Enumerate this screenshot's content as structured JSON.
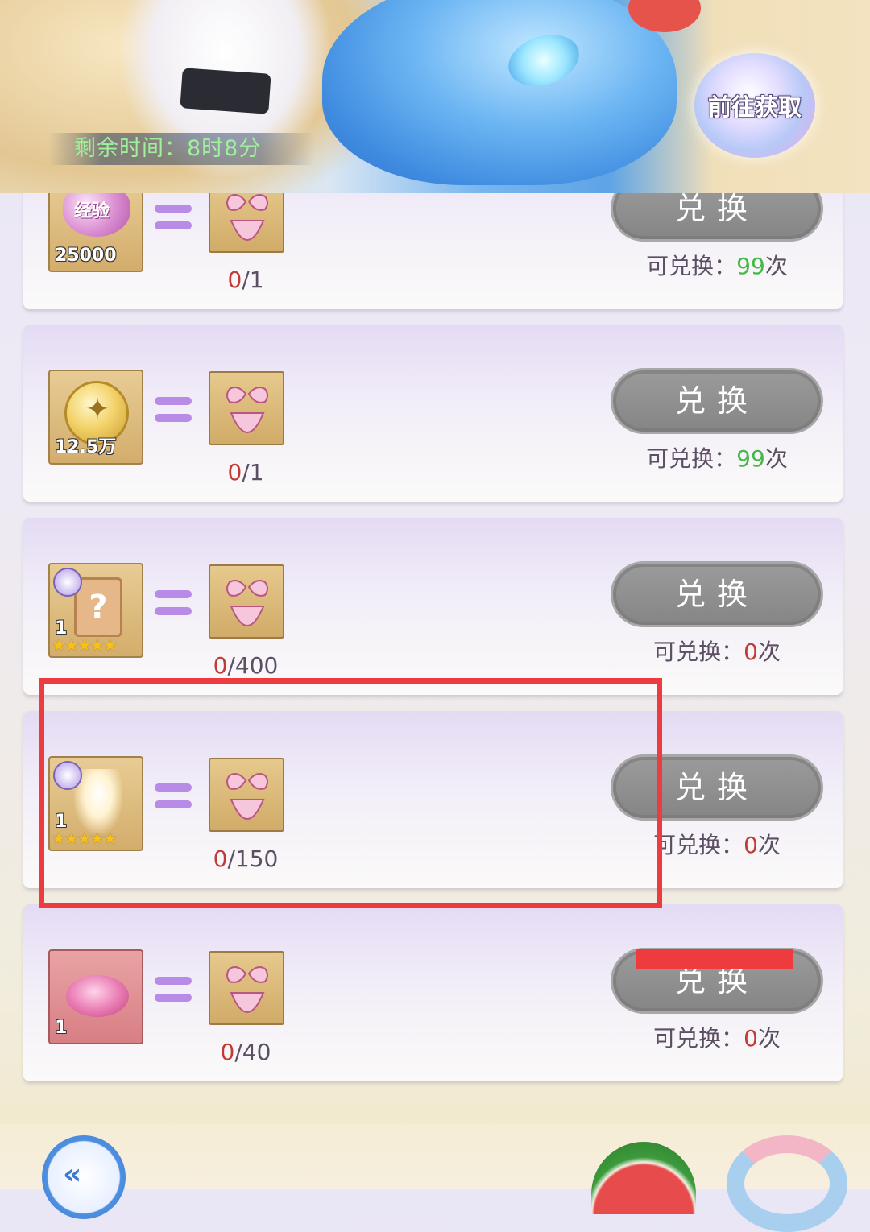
{
  "banner": {
    "timer_text": "剩余时间：8时8分",
    "goto_button_label": "前往获取"
  },
  "rows": [
    {
      "item_icon": "experience-heart-icon",
      "item_label": "经验",
      "item_qty": "25000",
      "reward_icon": "bikini-icon",
      "progress_have": "0",
      "progress_need": "/1",
      "button_label": "兑换",
      "limit_prefix": "可兑换：",
      "limit_count": "99",
      "limit_suffix": "次"
    },
    {
      "item_icon": "gold-coin-icon",
      "item_qty": "12.5万",
      "reward_icon": "bikini-icon",
      "progress_have": "0",
      "progress_need": "/1",
      "button_label": "兑换",
      "limit_prefix": "可兑换：",
      "limit_count": "99",
      "limit_suffix": "次"
    },
    {
      "item_icon": "mystery-card-icon",
      "item_qty": "1",
      "item_glyph": "?",
      "stars": "★★★★★",
      "reward_icon": "bikini-icon",
      "progress_have": "0",
      "progress_need": "/400",
      "button_label": "兑换",
      "limit_prefix": "可兑换：",
      "limit_count": "0",
      "limit_suffix": "次"
    },
    {
      "item_icon": "fairy-shard-icon",
      "item_qty": "1",
      "stars": "★★★★★",
      "reward_icon": "bikini-icon",
      "progress_have": "0",
      "progress_need": "/150",
      "button_label": "兑换",
      "limit_prefix": "可兑换：",
      "limit_count": "0",
      "limit_suffix": "次"
    },
    {
      "item_icon": "lips-icon",
      "item_qty": "1",
      "reward_icon": "bikini-icon",
      "progress_have": "0",
      "progress_need": "/40",
      "button_label": "兑换",
      "limit_prefix": "可兑换：",
      "limit_count": "0",
      "limit_suffix": "次"
    }
  ],
  "bottom": {
    "back_icon": "back-arrow-icon",
    "back_glyph": "«"
  },
  "colors": {
    "accent_red": "#ee3b3f",
    "count_green": "#46b84a",
    "count_red": "#c23a35",
    "button_gray": "#8f8f8f"
  }
}
